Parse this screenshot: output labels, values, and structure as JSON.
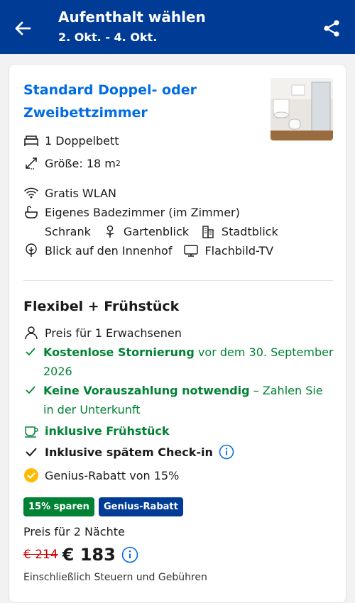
{
  "header": {
    "title": "Aufenthalt wählen",
    "dates": "2. Okt. - 4. Okt."
  },
  "room": {
    "title": "Standard Doppel- oder Zweibettzimmer",
    "bed": "1 Doppelbett",
    "size_label": "Größe: 18 m",
    "size_sup": "2",
    "amenities": {
      "wifi": "Gratis WLAN",
      "bathroom": "Eigenes Badezimmer (im Zimmer)",
      "wardrobe": "Schrank",
      "garden_view": "Gartenblick",
      "city_view": "Stadtblick",
      "courtyard": "Blick auf den Innenhof",
      "tv": "Flachbild-TV"
    }
  },
  "offer": {
    "plan_title": "Flexibel + Frühstück",
    "guests": "Preis für 1 Erwachsenen",
    "cancellation_bold": "Kostenlose Stornierung",
    "cancellation_rest": "vor dem 30. September 2026",
    "prepay_bold": "Keine Vorauszahlung notwendig",
    "prepay_rest": "– Zahlen Sie in der Unterkunft",
    "breakfast": "inklusive Frühstück",
    "late_checkin": "Inklusive spätem Check-in",
    "genius": "Genius-Rabatt von 15%"
  },
  "badges": {
    "savings": "15% sparen",
    "genius": "Genius-Rabatt"
  },
  "price": {
    "nights_label": "Preis für 2 Nächte",
    "old": "€ 214",
    "new": "€ 183",
    "taxes": "Einschließlich Steuern und Gebühren"
  },
  "colors": {
    "brand": "#003b95",
    "link": "#006ce4",
    "green": "#008234",
    "genius_yellow": "#febb02",
    "old_price": "#cc0000"
  }
}
